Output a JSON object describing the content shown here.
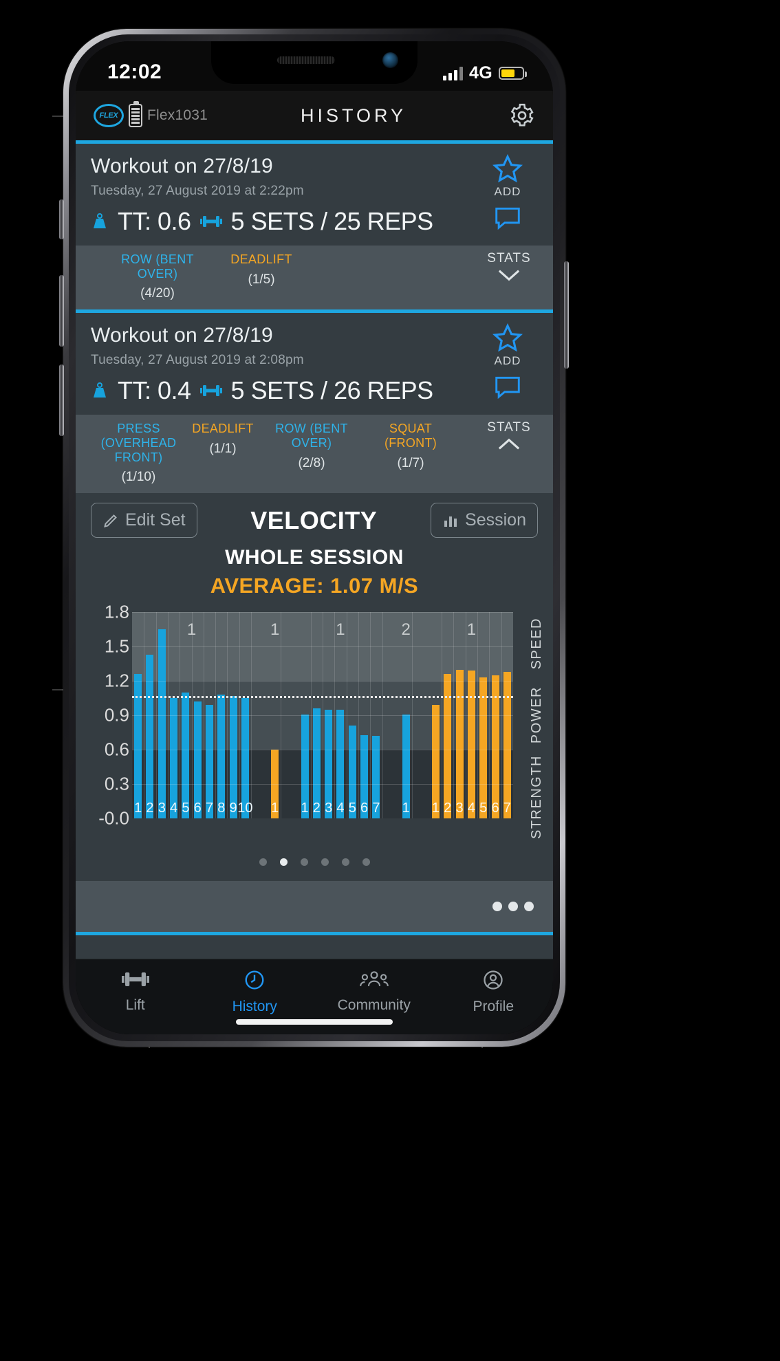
{
  "status_bar": {
    "time": "12:02",
    "network": "4G"
  },
  "app_header": {
    "device_name": "Flex1031",
    "logo_text": "FLEX",
    "title": "HISTORY"
  },
  "workouts": [
    {
      "title": "Workout on 27/8/19",
      "subtitle": "Tuesday, 27 August 2019 at 2:22pm",
      "tt": "TT: 0.6",
      "sets_reps": "5 SETS / 25 REPS",
      "add_label": "ADD",
      "stats_label": "STATS",
      "chevron": "down",
      "exercises": [
        {
          "name": "ROW (BENT OVER)",
          "count": "(4/20)",
          "color": "#2eb3ea"
        },
        {
          "name": "DEADLIFT",
          "count": "(1/5)",
          "color": "#f5a623"
        }
      ]
    },
    {
      "title": "Workout on 27/8/19",
      "subtitle": "Tuesday, 27 August 2019 at 2:08pm",
      "tt": "TT: 0.4",
      "sets_reps": "5 SETS / 26 REPS",
      "add_label": "ADD",
      "stats_label": "STATS",
      "chevron": "up",
      "exercises": [
        {
          "name": "PRESS (OVERHEAD FRONT)",
          "count": "(1/10)",
          "color": "#2eb3ea"
        },
        {
          "name": "DEADLIFT",
          "count": "(1/1)",
          "color": "#f5a623"
        },
        {
          "name": "ROW (BENT OVER)",
          "count": "(2/8)",
          "color": "#2eb3ea"
        },
        {
          "name": "SQUAT (FRONT)",
          "count": "(1/7)",
          "color": "#f5a623"
        }
      ]
    }
  ],
  "panel": {
    "edit_set_label": "Edit Set",
    "session_label": "Session",
    "title": "VELOCITY",
    "subtitle": "WHOLE SESSION",
    "average": "AVERAGE: 1.07 M/S",
    "page_dots": 6,
    "active_dot": 1
  },
  "chart_data": {
    "type": "bar",
    "title": "VELOCITY",
    "subtitle": "WHOLE SESSION",
    "annotation": "AVERAGE: 1.07 M/S",
    "ylabel": "",
    "xlabel": "",
    "ylim": [
      0,
      1.8
    ],
    "yticks": [
      "-0.0",
      "0.3",
      "0.6",
      "0.9",
      "1.2",
      "1.5",
      "1.8"
    ],
    "ytick_values": [
      0,
      0.3,
      0.6,
      0.9,
      1.2,
      1.5,
      1.8
    ],
    "average_line": 1.07,
    "grid": true,
    "zones": [
      {
        "name": "SPEED",
        "range": [
          1.2,
          1.8
        ],
        "color": "#5b6468"
      },
      {
        "name": "POWER",
        "range": [
          0.6,
          1.2
        ],
        "color": "#454e53"
      },
      {
        "name": "STRENGTH",
        "range": [
          0.0,
          0.6
        ],
        "color": "#2c3338"
      }
    ],
    "sets": [
      {
        "set_label": "1",
        "color": "#17a3dd",
        "rep_labels": [
          "1",
          "2",
          "3",
          "4",
          "5",
          "6",
          "7",
          "8",
          "9",
          "10"
        ],
        "values": [
          1.26,
          1.43,
          1.65,
          1.05,
          1.1,
          1.02,
          0.99,
          1.08,
          1.07,
          1.05
        ]
      },
      {
        "set_label": "1",
        "color": "#f5a623",
        "rep_labels": [
          "1"
        ],
        "values": [
          0.6
        ]
      },
      {
        "set_label": "1",
        "color": "#17a3dd",
        "rep_labels": [
          "1",
          "2",
          "3",
          "4",
          "5",
          "6",
          "7"
        ],
        "values": [
          0.91,
          0.96,
          0.95,
          0.95,
          0.81,
          0.73,
          0.72
        ]
      },
      {
        "set_label": "2",
        "color": "#17a3dd",
        "rep_labels": [
          "1"
        ],
        "values": [
          0.91
        ]
      },
      {
        "set_label": "1",
        "color": "#f5a623",
        "rep_labels": [
          "1",
          "2",
          "3",
          "4",
          "5",
          "6",
          "7"
        ],
        "values": [
          0.99,
          1.26,
          1.3,
          1.29,
          1.23,
          1.25,
          1.28
        ]
      }
    ]
  },
  "tabs": [
    {
      "label": "Lift",
      "icon": "dumbbell-icon",
      "active": false
    },
    {
      "label": "History",
      "icon": "history-clock-icon",
      "active": true
    },
    {
      "label": "Community",
      "icon": "people-icon",
      "active": false
    },
    {
      "label": "Profile",
      "icon": "person-circle-icon",
      "active": false
    }
  ]
}
